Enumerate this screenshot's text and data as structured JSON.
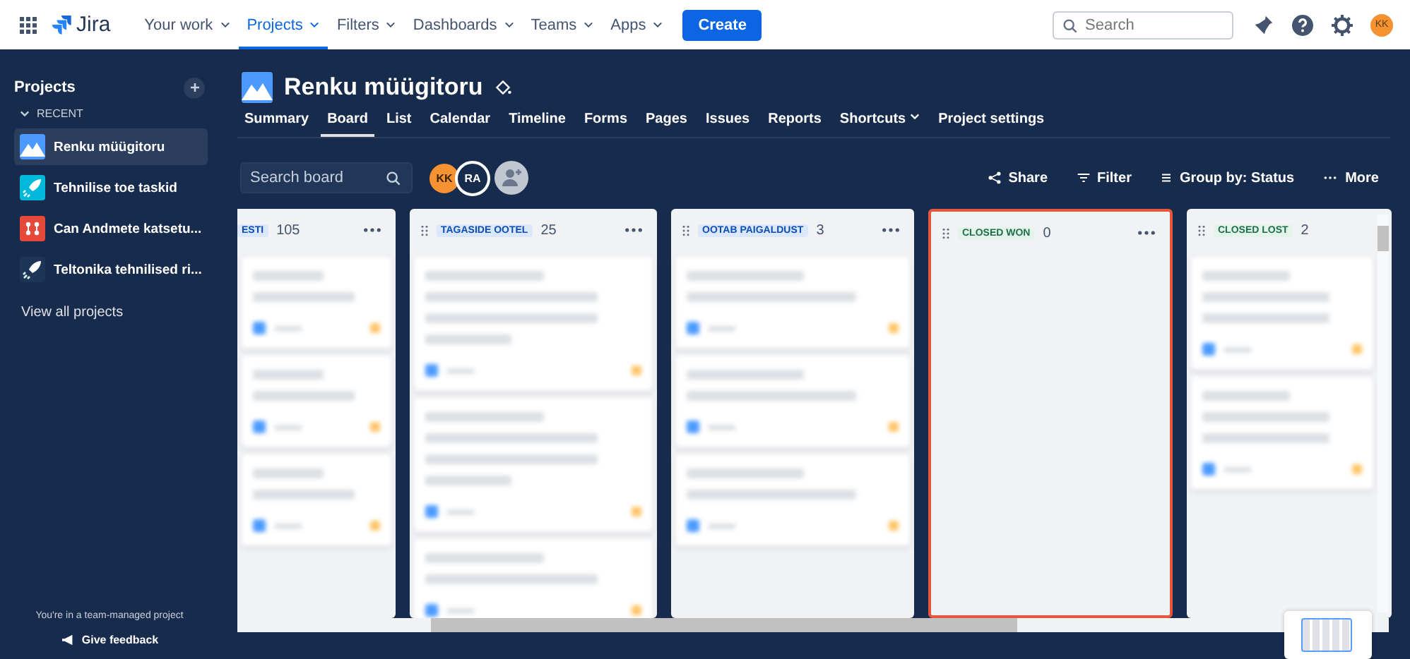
{
  "top_nav": {
    "product": "Jira",
    "items": [
      {
        "label": "Your work",
        "selected": false
      },
      {
        "label": "Projects",
        "selected": true
      },
      {
        "label": "Filters",
        "selected": false
      },
      {
        "label": "Dashboards",
        "selected": false
      },
      {
        "label": "Teams",
        "selected": false
      },
      {
        "label": "Apps",
        "selected": false
      }
    ],
    "create_button": "Create",
    "search": {
      "placeholder": "Search"
    },
    "user_initials": "KK"
  },
  "sidebar": {
    "title": "Projects",
    "section": "RECENT",
    "items": [
      {
        "label": "Renku müügitoru",
        "kind": "mountain",
        "selected": true
      },
      {
        "label": "Tehnilise toe taskid",
        "kind": "rocket",
        "selected": false
      },
      {
        "label": "Can Andmete katsetu...",
        "kind": "nodes",
        "selected": false
      },
      {
        "label": "Teltonika tehnilised ri...",
        "kind": "rocket",
        "selected": false
      }
    ],
    "view_all": "View all projects",
    "footer_note": "You're in a team-managed project",
    "feedback": "Give feedback"
  },
  "project": {
    "title": "Renku müügitoru",
    "tabs": [
      {
        "label": "Summary",
        "selected": false
      },
      {
        "label": "Board",
        "selected": true
      },
      {
        "label": "List",
        "selected": false
      },
      {
        "label": "Calendar",
        "selected": false
      },
      {
        "label": "Timeline",
        "selected": false
      },
      {
        "label": "Forms",
        "selected": false
      },
      {
        "label": "Pages",
        "selected": false
      },
      {
        "label": "Issues",
        "selected": false
      },
      {
        "label": "Reports",
        "selected": false
      },
      {
        "label": "Shortcuts",
        "selected": false,
        "dropdown": true
      },
      {
        "label": "Project settings",
        "selected": false
      }
    ]
  },
  "toolbar": {
    "search": {
      "placeholder": "Search board"
    },
    "avatars": [
      {
        "initials": "KK",
        "kind": "filled"
      },
      {
        "initials": "RA",
        "kind": "outlined"
      }
    ],
    "actions": [
      {
        "label": "Share",
        "kind": "share"
      },
      {
        "label": "Filter",
        "kind": "filter"
      },
      {
        "label": "Group by: Status",
        "kind": "group"
      },
      {
        "label": "More",
        "kind": "more"
      }
    ]
  },
  "board": {
    "columns": [
      {
        "label": "ESTI",
        "count": "105",
        "kind": "progress",
        "highlighted": false,
        "menu": true,
        "cards": [
          {
            "kind": "short"
          },
          {
            "kind": "short"
          },
          {
            "kind": "short"
          }
        ]
      },
      {
        "label": "TAGASIDE OOTEL",
        "count": "25",
        "kind": "progress",
        "highlighted": false,
        "menu": true,
        "cards": [
          {
            "kind": "long"
          },
          {
            "kind": "long"
          },
          {
            "kind": "short"
          }
        ]
      },
      {
        "label": "OOTAB PAIGALDUST",
        "count": "3",
        "kind": "progress",
        "highlighted": false,
        "menu": true,
        "cards": [
          {
            "kind": "short"
          },
          {
            "kind": "short"
          },
          {
            "kind": "short"
          }
        ]
      },
      {
        "label": "CLOSED WON",
        "count": "0",
        "kind": "done",
        "highlighted": true,
        "menu": true
      },
      {
        "label": "CLOSED LOST",
        "count": "2",
        "kind": "done",
        "highlighted": false,
        "menu": false,
        "cards": [
          {
            "kind": "medium"
          },
          {
            "kind": "medium"
          }
        ]
      }
    ]
  }
}
